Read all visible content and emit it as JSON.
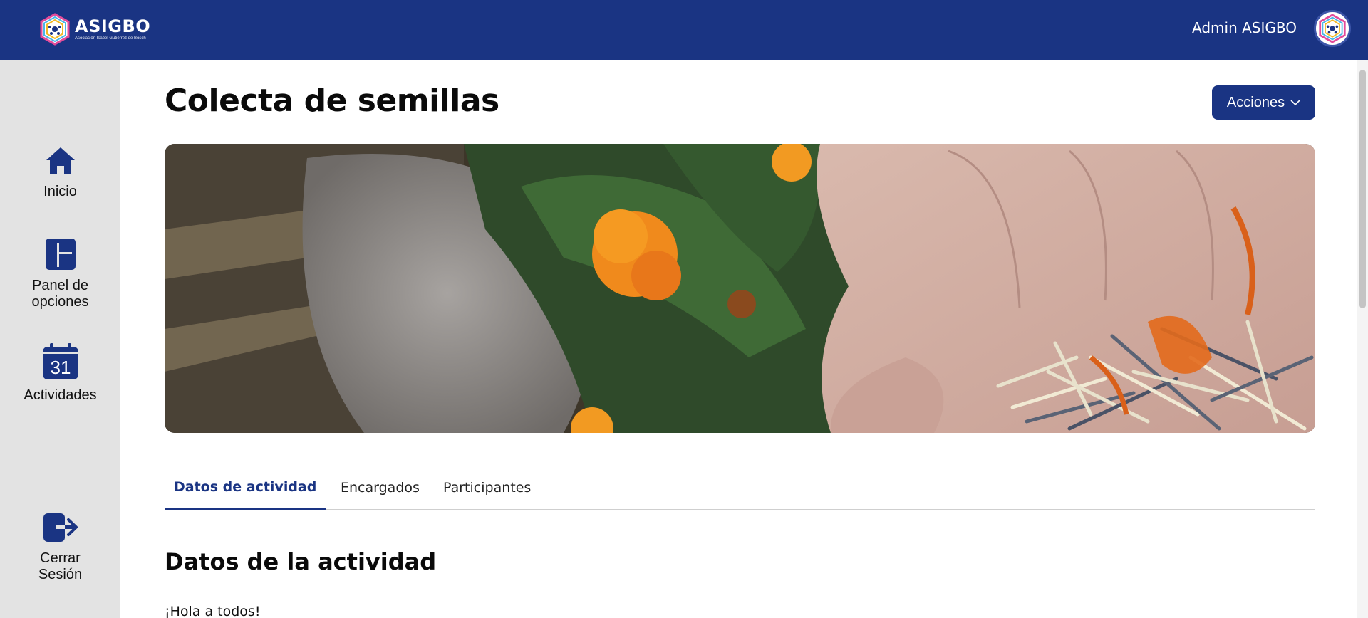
{
  "header": {
    "brand_name": "ASIGBO",
    "brand_subtitle": "Asociación Isabel Gutiérrez de Bosch",
    "user_name": "Admin ASIGBO",
    "logo_icon": "hexagon-logo-icon"
  },
  "sidebar": {
    "items": [
      {
        "label": "Inicio",
        "icon": "home-icon"
      },
      {
        "label": "Panel de opciones",
        "icon": "dashboard-icon"
      },
      {
        "label": "Actividades",
        "icon": "calendar-icon",
        "calendar_day": "31"
      },
      {
        "label": "Cerrar Sesión",
        "icon": "logout-icon"
      }
    ]
  },
  "page": {
    "title": "Colecta de semillas",
    "actions_label": "Acciones",
    "tabs": [
      {
        "label": "Datos de actividad",
        "active": true
      },
      {
        "label": "Encargados",
        "active": false
      },
      {
        "label": "Participantes",
        "active": false
      }
    ],
    "section_title": "Datos de la actividad",
    "body_text": "¡Hola a todos!"
  },
  "colors": {
    "primary": "#1a3483",
    "sidebar_bg": "#e3e3e3"
  }
}
